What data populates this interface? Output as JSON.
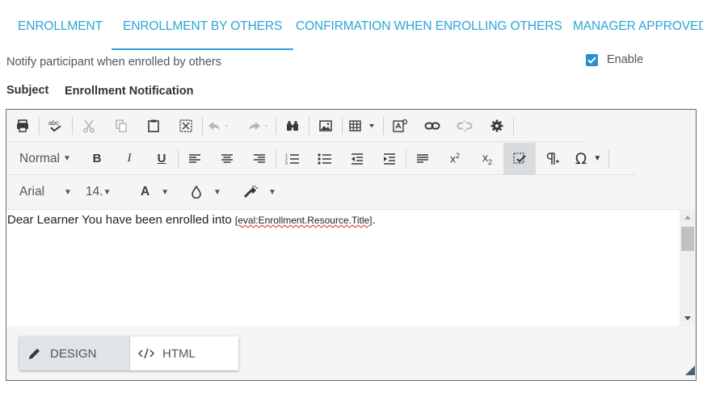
{
  "tabs": [
    {
      "label": "ENROLLMENT",
      "active": false
    },
    {
      "label": "ENROLLMENT BY OTHERS",
      "active": true
    },
    {
      "label": "CONFIRMATION WHEN ENROLLING OTHERS",
      "active": false
    },
    {
      "label": "MANAGER APPROVED",
      "active": false
    }
  ],
  "notify": {
    "label": "Notify participant when enrolled by others",
    "enable_label": "Enable",
    "enabled": true
  },
  "subject": {
    "label": "Subject",
    "value": "Enrollment Notification"
  },
  "toolbar": {
    "row1": [
      "print-icon",
      "spellcheck-icon",
      "cut-icon",
      "copy-icon",
      "paste-icon",
      "select-all-icon",
      "undo-icon",
      "redo-icon",
      "find-icon",
      "image-icon",
      "table-icon",
      "insert-form-icon",
      "link-icon",
      "unlink-icon",
      "settings-icon"
    ],
    "row2": [
      "bold-icon",
      "italic-icon",
      "underline-icon",
      "align-left-icon",
      "align-center-icon",
      "align-right-icon",
      "numbered-list-icon",
      "bulleted-list-icon",
      "outdent-icon",
      "indent-icon",
      "paragraph-format-icon",
      "superscript-icon",
      "subscript-icon",
      "format-stripper-icon",
      "show-formatting-icon",
      "special-character-icon"
    ],
    "row3": [
      "font-family-dropdown",
      "font-size-dropdown",
      "text-color-icon",
      "background-color-icon",
      "format-painter-icon"
    ],
    "format_block": "Normal",
    "font_family": "Arial",
    "font_size": "14.",
    "text_color_glyph": "A"
  },
  "editor": {
    "text": "Dear Learner  You have been enrolled into ",
    "token": "[eval:Enrollment.Resource.Title]",
    "after_token": "."
  },
  "modes": [
    {
      "label": "DESIGN",
      "icon": "pencil-icon",
      "active": true
    },
    {
      "label": "HTML",
      "icon": "code-icon",
      "active": false
    }
  ],
  "colors": {
    "accent": "#2aa5d8",
    "checkbox": "#2a8fd0",
    "icon": "#3a3a3a",
    "icon_disabled": "#b5b5b5"
  }
}
